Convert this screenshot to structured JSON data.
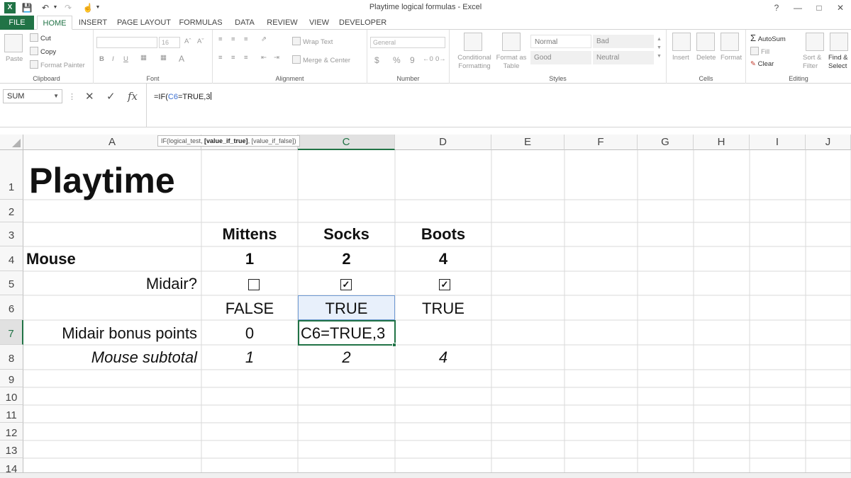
{
  "window": {
    "title": "Playtime logical formulas - Excel",
    "controls": [
      "?",
      "—",
      "□",
      "✕"
    ]
  },
  "quick_access": [
    "excel-logo",
    "save-icon",
    "undo-icon",
    "redo-icon",
    "touch-mode-icon"
  ],
  "tabs": [
    "FILE",
    "HOME",
    "INSERT",
    "PAGE LAYOUT",
    "FORMULAS",
    "DATA",
    "REVIEW",
    "VIEW",
    "DEVELOPER"
  ],
  "active_tab": "HOME",
  "ribbon": {
    "clipboard": {
      "label": "Clipboard",
      "paste": "Paste",
      "cut": "Cut",
      "copy": "Copy",
      "format_painter": "Format Painter"
    },
    "font": {
      "label": "Font",
      "size": "16",
      "bold": "B",
      "italic": "I",
      "underline": "U"
    },
    "alignment": {
      "label": "Alignment",
      "wrap_text": "Wrap Text",
      "merge_center": "Merge & Center"
    },
    "number": {
      "label": "Number",
      "format": "General",
      "currency": "$",
      "percent": "%",
      "comma": "9"
    },
    "styles": {
      "label": "Styles",
      "conditional_formatting": "Conditional Formatting",
      "format_as_table": "Format as Table",
      "normal": "Normal",
      "bad": "Bad",
      "good": "Good",
      "neutral": "Neutral"
    },
    "cells": {
      "label": "Cells",
      "insert": "Insert",
      "delete": "Delete",
      "format": "Format"
    },
    "editing": {
      "label": "Editing",
      "autosum": "AutoSum",
      "fill": "Fill",
      "clear": "Clear",
      "sort_filter": "Sort & Filter",
      "find_select": "Find & Select"
    }
  },
  "formula_bar": {
    "name_box": "SUM",
    "cancel": "✕",
    "enter": "✓",
    "fx": "fx",
    "formula_prefix": "=IF(",
    "formula_ref": "C6",
    "formula_suffix": "=TRUE,3"
  },
  "tooltip": {
    "prefix": "IF(logical_test, ",
    "bold": "[value_if_true]",
    "suffix": ", [value_if_false])"
  },
  "columns": [
    "A",
    "B",
    "C",
    "D",
    "E",
    "F",
    "G",
    "H",
    "I",
    "J"
  ],
  "rows": [
    "1",
    "2",
    "3",
    "4",
    "5",
    "6",
    "7",
    "8",
    "9",
    "10",
    "11",
    "12",
    "13",
    "14"
  ],
  "name_box_cell": "C7",
  "sheet": {
    "title": "Playtime",
    "headers": [
      "Mittens",
      "Socks",
      "Boots"
    ],
    "mouse_label": "Mouse",
    "mouse_values": [
      "1",
      "2",
      "4"
    ],
    "midair_label": "Midair?",
    "midair_checked": [
      false,
      true,
      true
    ],
    "midair_results": [
      "FALSE",
      "TRUE",
      "TRUE"
    ],
    "bonus_label": "Midair bonus points",
    "bonus_b": "0",
    "bonus_c_edit": "C6=TRUE,3",
    "subtotal_label": "Mouse subtotal",
    "subtotal_values": [
      "1",
      "2",
      "4"
    ]
  },
  "colors": {
    "excel_green": "#217346",
    "ref_blue": "#3b6fd1",
    "selection_fill": "#e8f0fb"
  }
}
